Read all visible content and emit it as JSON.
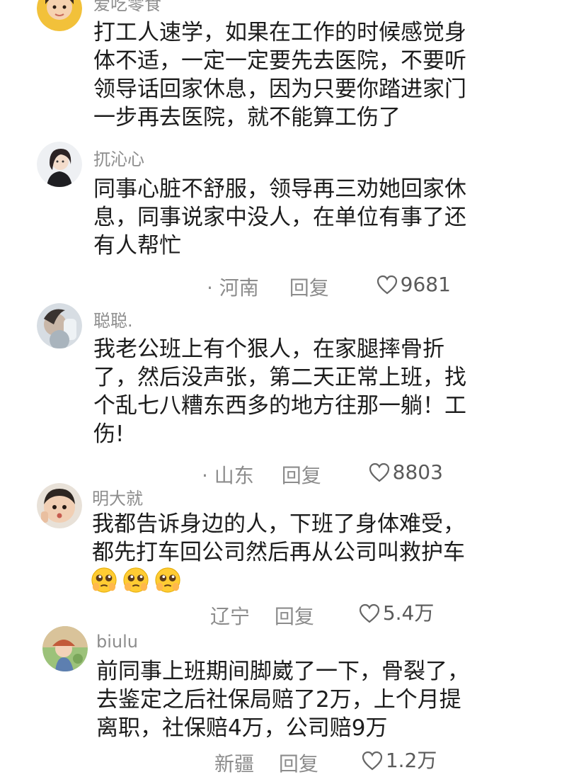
{
  "comments": [
    {
      "username": "爱吃零食",
      "lines": [
        "打工人速学，如果在工作的时候感觉身",
        "体不适，一定一定要先去医院，不要听",
        "领导话回家休息，因为只要你踏进家门",
        "一步再去医院，就不能算工伤了"
      ],
      "avatar": "avatar-girl-yellow"
    },
    {
      "username": "扤沁心",
      "lines": [
        "同事心脏不舒服，领导再三劝她回家休",
        "息，同事说家中没人，在单位有事了还",
        "有人帮忙"
      ],
      "location": "· 河南",
      "reply": "回复",
      "likes": "9681",
      "avatar": "avatar-woman"
    },
    {
      "username": "聪聪.",
      "lines": [
        "我老公班上有个狠人，在家腿摔骨折",
        "了，然后没声张，第二天正常上班，找",
        "个乱七八糟东西多的地方往那一躺！工",
        "伤!"
      ],
      "location": "· 山东",
      "reply": "回复",
      "likes": "8803",
      "avatar": "avatar-blurred"
    },
    {
      "username": "明大就",
      "lines": [
        "我都告诉身边的人，下班了身体难受，",
        "都先打车回公司然后再从公司叫救护车"
      ],
      "emojis": [
        "pleading-face-icon",
        "pleading-face-icon",
        "pleading-face-icon"
      ],
      "location": "辽宁",
      "reply": "回复",
      "likes": "5.4万",
      "avatar": "avatar-child"
    },
    {
      "username": "biulu",
      "lines": [
        "前同事上班期间脚崴了一下，骨裂了，",
        "去鉴定之后社保局赔了2万，上个月提",
        "离职，社保赔4万，公司赔9万"
      ],
      "location": "新疆",
      "reply": "回复",
      "likes": "1.2万",
      "avatar": "avatar-illustration"
    }
  ],
  "colors": {
    "text": "#1c1c1c",
    "meta": "#8c8c8c",
    "username": "#8d8d8d"
  }
}
